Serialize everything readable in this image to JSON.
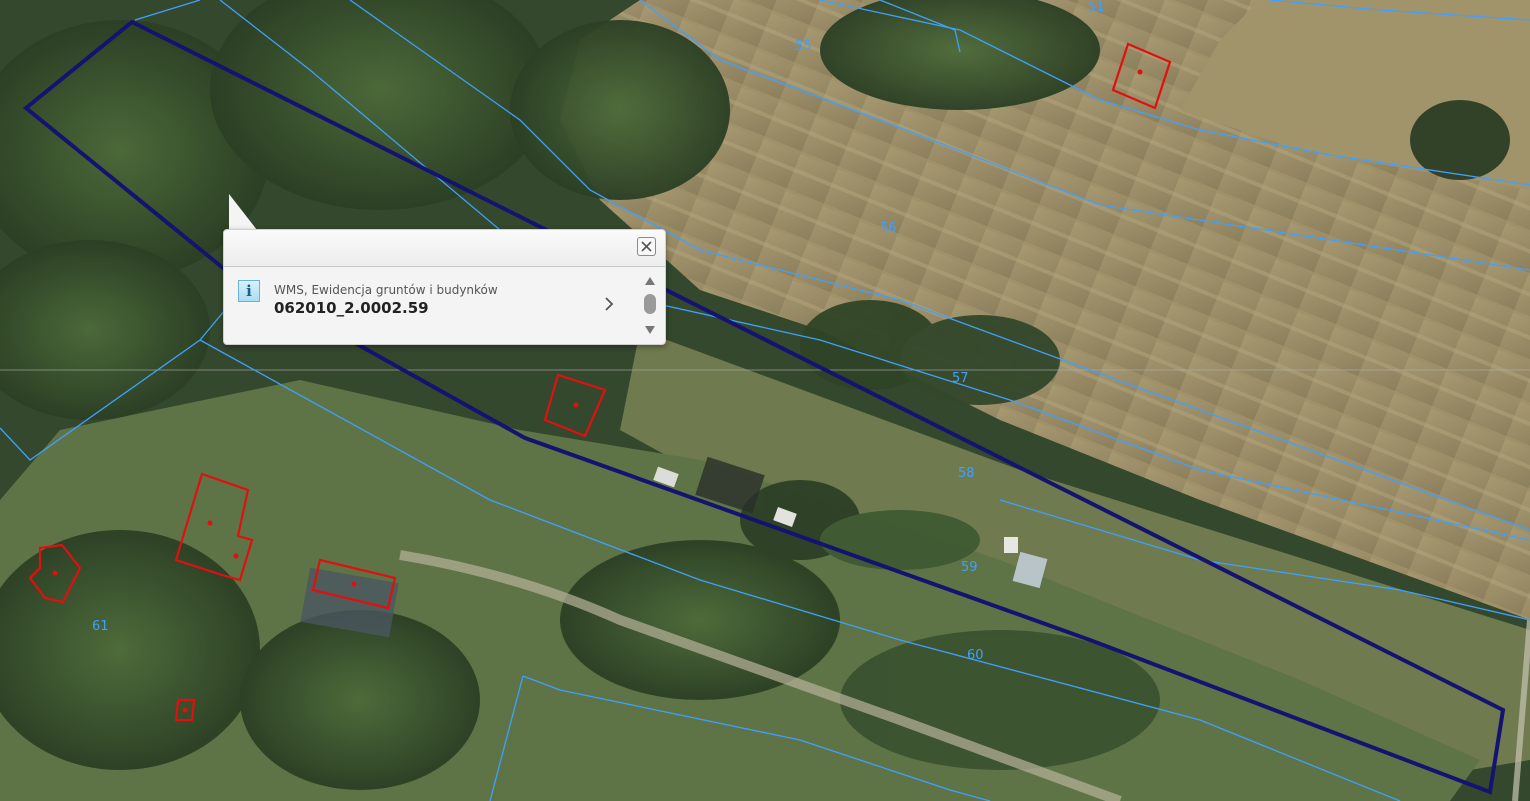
{
  "map": {
    "parcel_labels": [
      "51",
      "55",
      "56",
      "57",
      "58",
      "59",
      "60",
      "61"
    ],
    "colors": {
      "parcel_boundary": "#3fa0ff",
      "selected_parcel": "#141470",
      "building": "#e01010"
    }
  },
  "popup": {
    "layer_name": "WMS, Ewidencja gruntów i budynków",
    "feature_id": "062010_2.0002.59",
    "icons": [
      "info-icon",
      "close-icon",
      "chevron-right-icon",
      "scroll-up-icon",
      "scroll-down-icon"
    ]
  }
}
